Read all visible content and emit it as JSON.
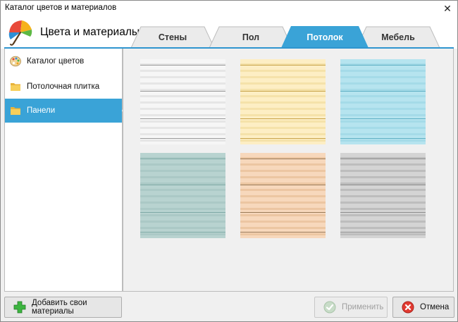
{
  "window": {
    "title": "Каталог цветов и материалов"
  },
  "header": {
    "title": "Цвета и материалы"
  },
  "tabs": [
    {
      "label": "Стены",
      "active": false
    },
    {
      "label": "Пол",
      "active": false
    },
    {
      "label": "Потолок",
      "active": true
    },
    {
      "label": "Мебель",
      "active": false
    }
  ],
  "sidebar": {
    "items": [
      {
        "label": "Каталог цветов",
        "icon": "palette-icon",
        "active": false
      },
      {
        "label": "Потолочная плитка",
        "icon": "folder-icon",
        "active": false
      },
      {
        "label": "Панели",
        "icon": "folder-icon",
        "active": true
      }
    ]
  },
  "panels": [
    {
      "name": "white-panel",
      "base": "#f6f6f6",
      "stripe": "#e6e6e6",
      "accent": "#9a9a9a"
    },
    {
      "name": "cream-panel",
      "base": "#fdeec4",
      "stripe": "#f5e2aa",
      "accent": "#c9a44a"
    },
    {
      "name": "light-blue-panel",
      "base": "#b6e4ef",
      "stripe": "#a5dbe8",
      "accent": "#5fb0c4"
    },
    {
      "name": "sage-green-panel",
      "base": "#b8d3d0",
      "stripe": "#abc9c6",
      "accent": "#7faaa6"
    },
    {
      "name": "peach-panel",
      "base": "#f7d8bc",
      "stripe": "#ecc6a2",
      "accent": "#9a7a58"
    },
    {
      "name": "gray-panel",
      "base": "#d4d4d4",
      "stripe": "#bdbdbd",
      "accent": "#8e8e8e"
    }
  ],
  "buttons": {
    "add_materials": "Добавить свои материалы",
    "apply": "Применить",
    "cancel": "Отмена"
  },
  "colors": {
    "accent": "#3aa3d7",
    "tab_inactive": "#ebebeb"
  }
}
